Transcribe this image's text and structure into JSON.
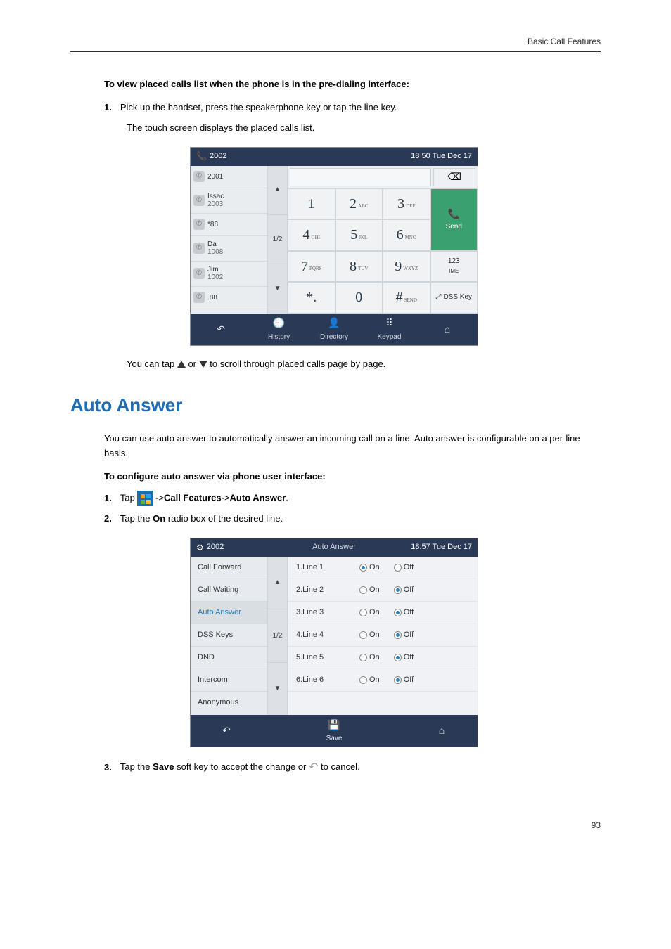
{
  "header": {
    "right": "Basic Call Features"
  },
  "section1": {
    "heading": "To view placed calls list when the phone is in the pre-dialing interface:",
    "step1_num": "1.",
    "step1": "Pick up the handset, press the speakerphone key or tap the line key.",
    "step1_sub": "The touch screen displays the placed calls list."
  },
  "shot1": {
    "top_left_num": "2002",
    "top_right": "18 50 Tue Dec 17",
    "calls": [
      {
        "line1": "2001",
        "line2": ""
      },
      {
        "line1": "Issac",
        "line2": "2003"
      },
      {
        "line1": "*88",
        "line2": ""
      },
      {
        "line1": "Da",
        "line2": "1008"
      },
      {
        "line1": "Jim",
        "line2": "1002"
      },
      {
        "line1": ".88",
        "line2": ""
      }
    ],
    "pager_mid": "1/2",
    "keys": {
      "k1": "1",
      "k2": "2",
      "k2s": "ABC",
      "k3": "3",
      "k3s": "DEF",
      "k4": "4",
      "k4s": "GHI",
      "k5": "5",
      "k5s": "JKL",
      "k6": "6",
      "k6s": "MNO",
      "k7": "7",
      "k7s": "PQRS",
      "k8": "8",
      "k8s": "TUV",
      "k9": "9",
      "k9s": "WXYZ",
      "kstar": "*.",
      "k0": "0",
      "kpound": "#",
      "kpounds": "SEND"
    },
    "side": {
      "send": "Send",
      "s123a": "123",
      "s123b": "IME",
      "dss": "DSS Key"
    },
    "backspace": "⌫",
    "bottom": {
      "history": "History",
      "directory": "Directory",
      "keypad": "Keypad"
    }
  },
  "after_shot1": {
    "pre": "You can tap ",
    "mid": " or ",
    "post": " to scroll through placed calls page by page."
  },
  "section2_title": "Auto Answer",
  "section2_intro": "You can use auto answer to automatically answer an incoming call on a line. Auto answer is configurable on a per-line basis.",
  "section2_heading": "To configure auto answer via phone user interface:",
  "section2_step1_num": "1.",
  "section2_step1_pre": "Tap ",
  "section2_step1_mid": " ->",
  "section2_step1_b1": "Call Features",
  "section2_step1_arrow": "->",
  "section2_step1_b2": "Auto Answer",
  "section2_step1_end": ".",
  "section2_step2_num": "2.",
  "section2_step2_pre": "Tap the ",
  "section2_step2_b": "On",
  "section2_step2_post": " radio box of the desired line.",
  "shot2": {
    "top_left": "2002",
    "top_center": "Auto Answer",
    "top_right": "18:57 Tue Dec 17",
    "menu": [
      "Call Forward",
      "Call Waiting",
      "Auto Answer",
      "DSS Keys",
      "DND",
      "Intercom",
      "Anonymous"
    ],
    "pager_mid": "1/2",
    "rows": [
      {
        "label": "1.Line 1",
        "on": true
      },
      {
        "label": "2.Line 2",
        "on": false
      },
      {
        "label": "3.Line 3",
        "on": false
      },
      {
        "label": "4.Line 4",
        "on": false
      },
      {
        "label": "5.Line 5",
        "on": false
      },
      {
        "label": "6.Line 6",
        "on": false
      }
    ],
    "on_label": "On",
    "off_label": "Off",
    "save": "Save"
  },
  "section2_step3_num": "3.",
  "section2_step3_pre": "Tap the ",
  "section2_step3_b": "Save",
  "section2_step3_mid": " soft key to accept the change or ",
  "section2_step3_post": " to cancel.",
  "page_num": "93"
}
